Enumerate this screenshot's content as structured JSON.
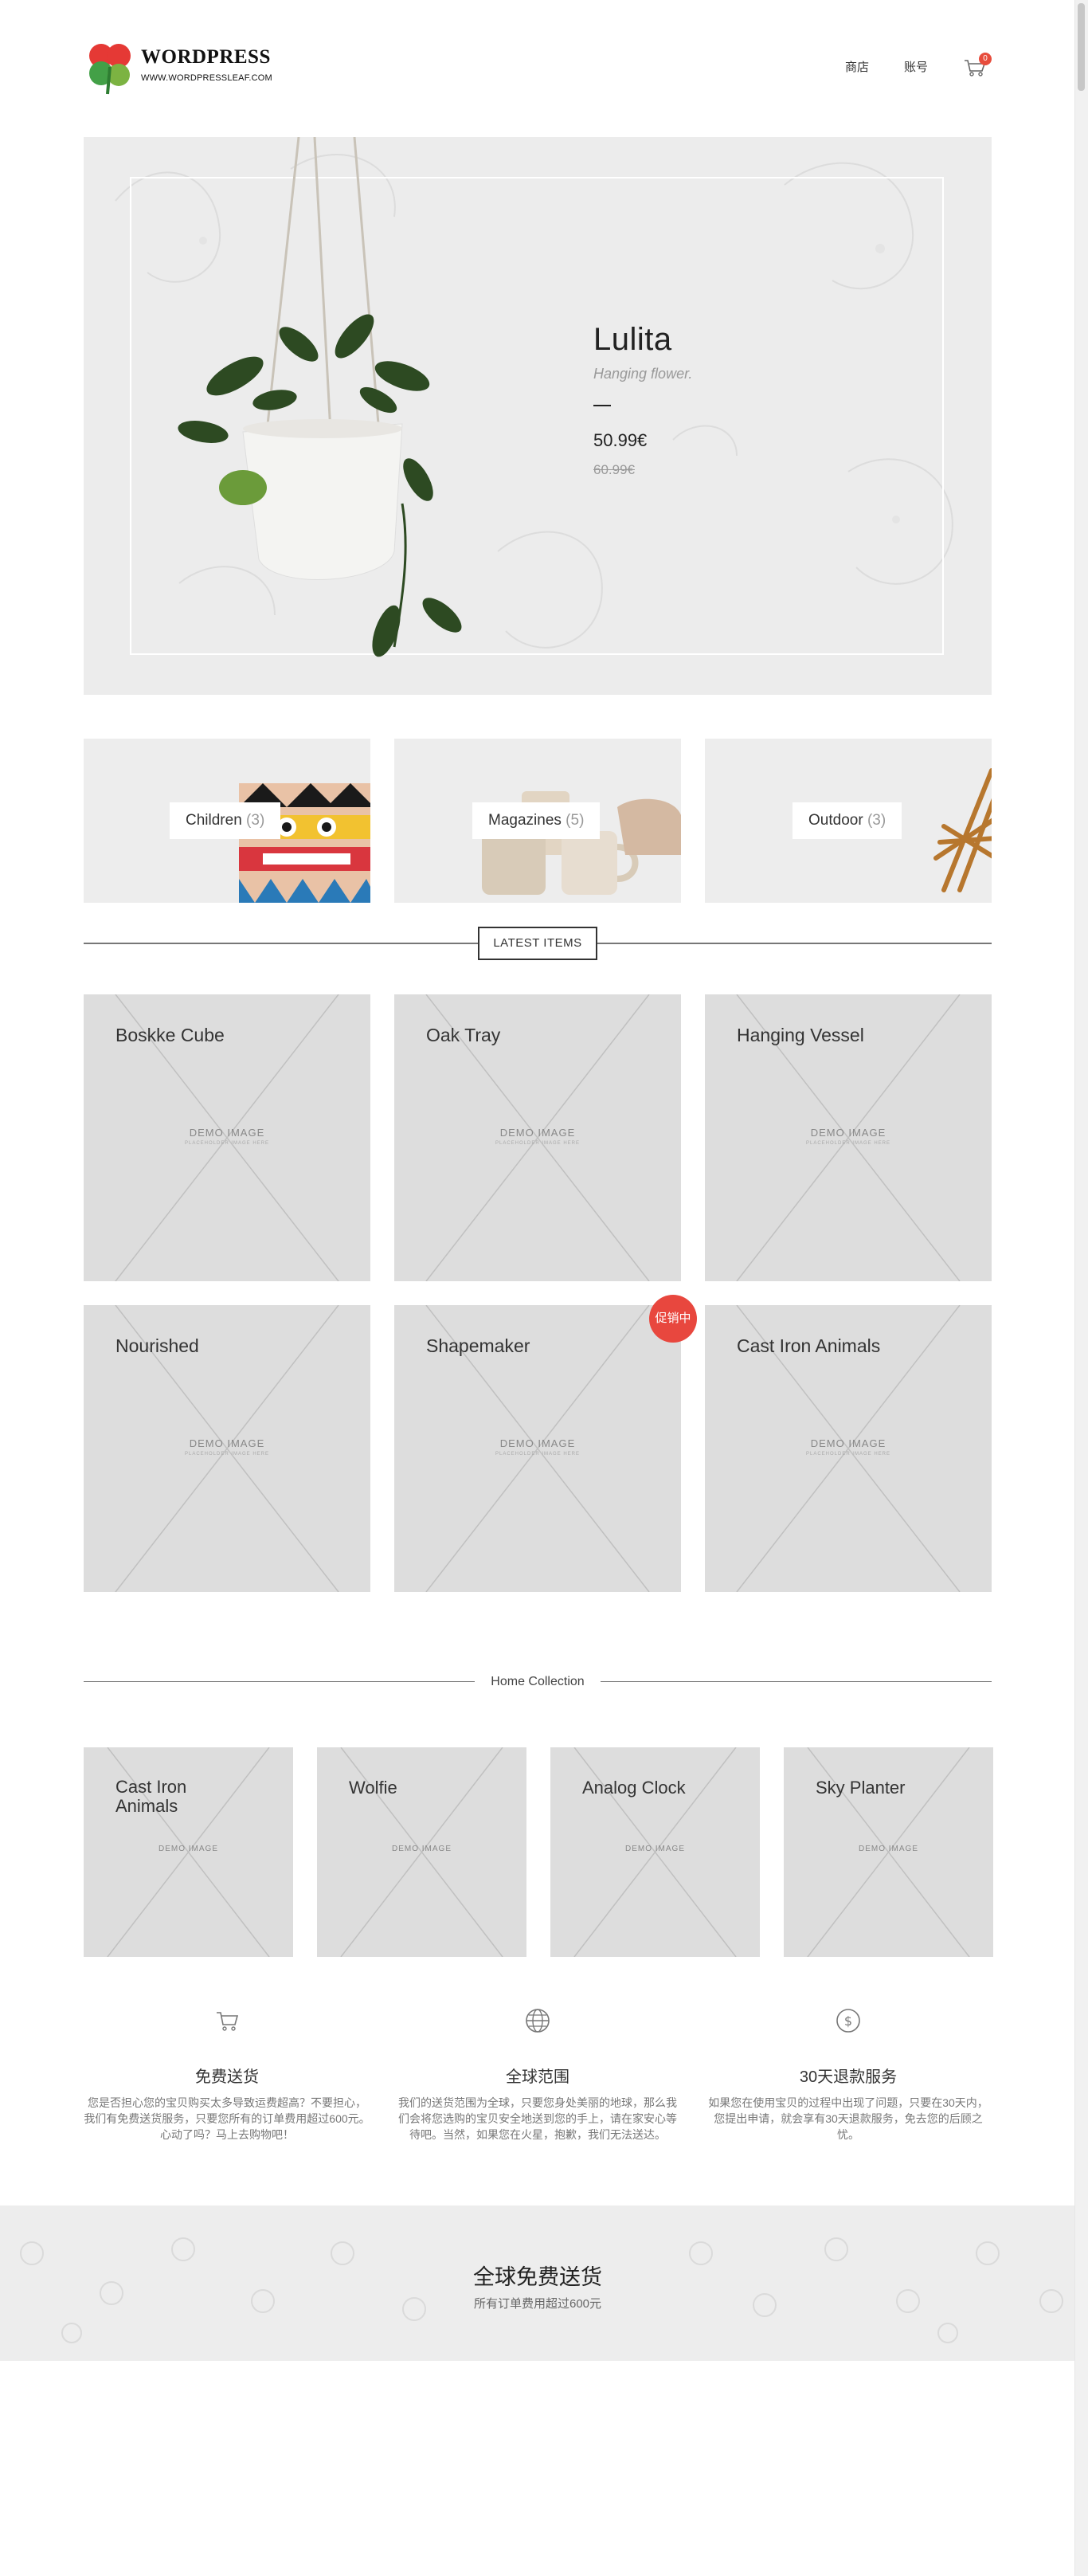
{
  "header": {
    "logo_text": "WORDPRESS",
    "logo_url": "WWW.WORDPRESSLEAF.COM",
    "nav": [
      "商店",
      "账号"
    ],
    "cart_count": "0",
    "cart_icon": "cart-icon"
  },
  "hero": {
    "title": "Lulita",
    "subtitle": "Hanging flower.",
    "price": "50.99€",
    "old_price": "60.99€"
  },
  "categories": [
    {
      "name": "Children",
      "count": "(3)"
    },
    {
      "name": "Magazines",
      "count": "(5)"
    },
    {
      "name": "Outdoor",
      "count": "(3)"
    }
  ],
  "latest": {
    "heading": "LATEST ITEMS",
    "demo_label": "DEMO IMAGE",
    "demo_sub": "PLACEHOLDER IMAGE HERE",
    "sale_badge": "促销中",
    "items": [
      "Boskke Cube",
      "Oak Tray",
      "Hanging Vessel",
      "Nourished",
      "Shapemaker",
      "Cast Iron Animals"
    ]
  },
  "collection": {
    "heading": "Home Collection",
    "items": [
      "Cast Iron Animals",
      "Wolfie",
      "Analog Clock",
      "Sky Planter"
    ]
  },
  "features": [
    {
      "icon": "cart-icon",
      "title": "免费送货",
      "text": "您是否担心您的宝贝购买太多导致运费超高？不要担心，我们有免费送货服务，只要您所有的订单费用超过600元。心动了吗？马上去购物吧！"
    },
    {
      "icon": "globe-icon",
      "title": "全球范围",
      "text": "我们的送货范围为全球，只要您身处美丽的地球，那么我们会将您选购的宝贝安全地送到您的手上，请在家安心等待吧。当然，如果您在火星，抱歉，我们无法送达。"
    },
    {
      "icon": "dollar-icon",
      "title": "30天退款服务",
      "text": "如果您在使用宝贝的过程中出现了问题，只要在30天内，您提出申请，就会享有30天退款服务，免去您的后顾之忧。"
    }
  ],
  "band": {
    "title": "全球免费送货",
    "subtitle": "所有订单费用超过600元"
  },
  "colors": {
    "accent": "#e8473e",
    "placeholder": "#dddddd",
    "panel": "#ececec"
  }
}
